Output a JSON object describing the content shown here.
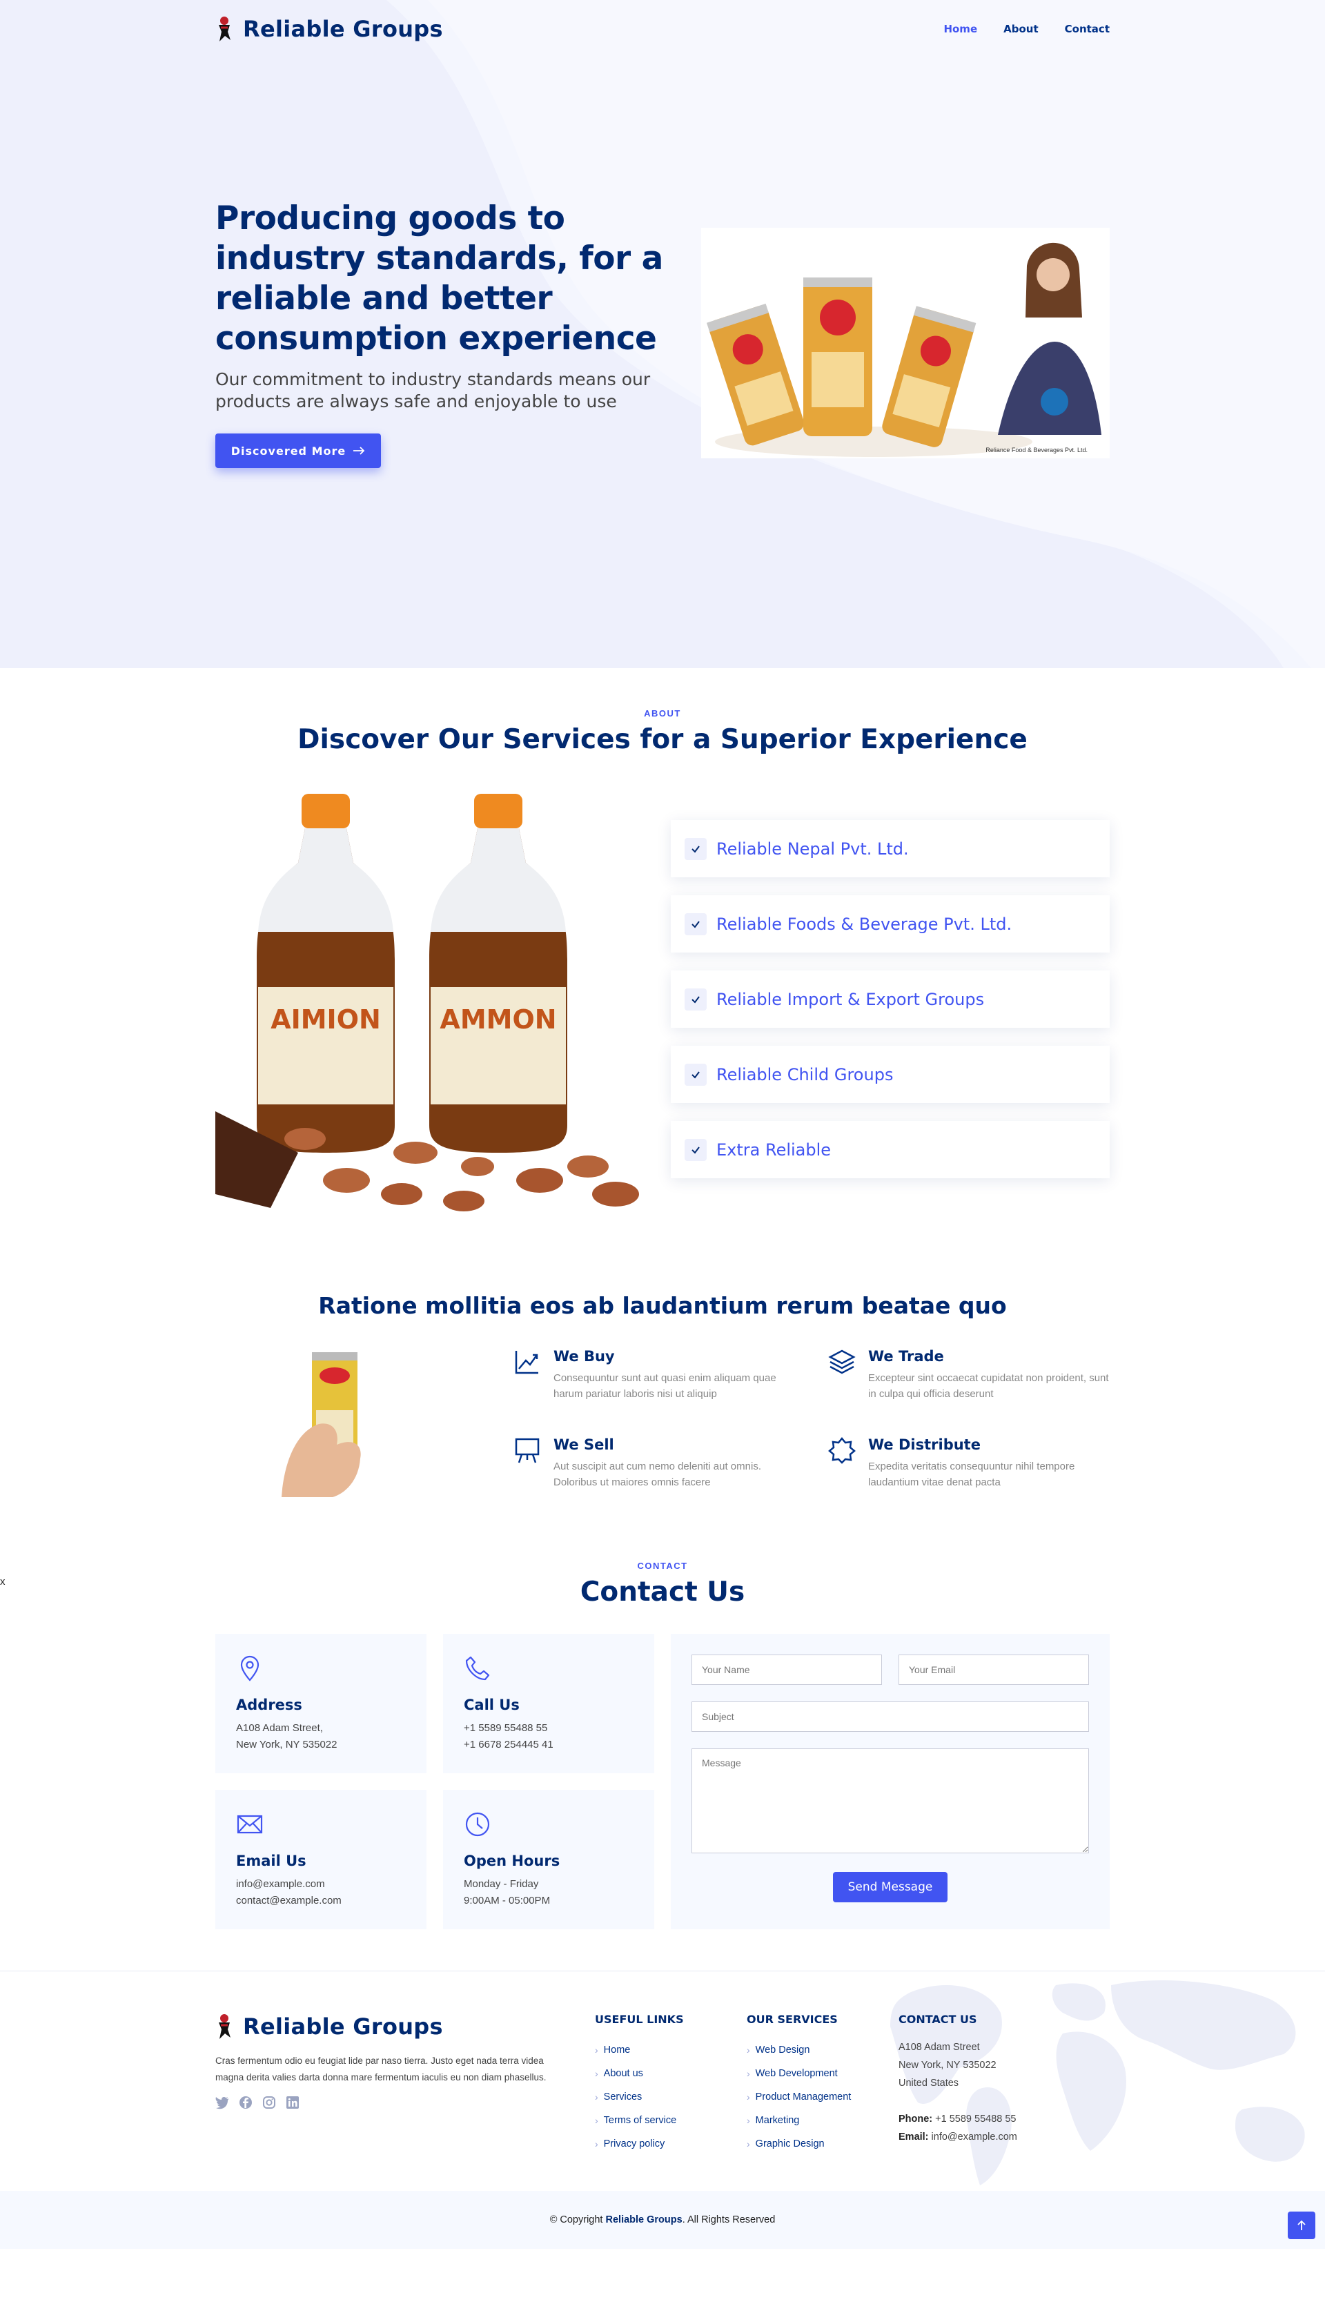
{
  "brand": {
    "name": "Reliable Groups"
  },
  "nav": {
    "home": "Home",
    "about": "About",
    "contact": "Contact"
  },
  "hero": {
    "title": "Producing goods to industry standards, for a reliable and better consumption experience",
    "subtitle": "Our commitment to industry standards means our products are always safe and enjoyable to use",
    "cta": "Discovered More",
    "image_caption": "Reliance Food & Beverages Pvt. Ltd."
  },
  "about": {
    "eyebrow": "About",
    "title": "Discover Our Services for a Superior Experience",
    "items": [
      "Reliable Nepal Pvt. Ltd.",
      "Reliable Foods & Beverage Pvt. Ltd.",
      "Reliable Import & Export Groups",
      "Reliable Child Groups",
      "Extra Reliable"
    ]
  },
  "features": {
    "title": "Ratione mollitia eos ab laudantium rerum beatae quo",
    "items": [
      {
        "title": "We Buy",
        "text": "Consequuntur sunt aut quasi enim aliquam quae harum pariatur laboris nisi ut aliquip",
        "icon": "graph-up-icon"
      },
      {
        "title": "We Trade",
        "text": "Excepteur sint occaecat cupidatat non proident, sunt in culpa qui officia deserunt",
        "icon": "layers-icon"
      },
      {
        "title": "We Sell",
        "text": "Aut suscipit aut cum nemo deleniti aut omnis. Doloribus ut maiores omnis facere",
        "icon": "easel-icon"
      },
      {
        "title": "We Distribute",
        "text": "Expedita veritatis consequuntur nihil tempore laudantium vitae denat pacta",
        "icon": "patch-check-icon"
      }
    ]
  },
  "stray_text": "x",
  "contact": {
    "eyebrow": "Contact",
    "title": "Contact Us",
    "boxes": [
      {
        "title": "Address",
        "line1": "A108 Adam Street,",
        "line2": "New York, NY 535022"
      },
      {
        "title": "Call Us",
        "line1": "+1 5589 55488 55",
        "line2": "+1 6678 254445 41"
      },
      {
        "title": "Email Us",
        "line1": "info@example.com",
        "line2": "contact@example.com"
      },
      {
        "title": "Open Hours",
        "line1": "Monday - Friday",
        "line2": "9:00AM - 05:00PM"
      }
    ],
    "form": {
      "name_placeholder": "Your Name",
      "email_placeholder": "Your Email",
      "subject_placeholder": "Subject",
      "message_placeholder": "Message",
      "submit": "Send Message"
    }
  },
  "footer": {
    "about_text": "Cras fermentum odio eu feugiat lide par naso tierra. Justo eget nada terra videa magna derita valies darta donna mare fermentum iaculis eu non diam phasellus.",
    "useful_links": {
      "title": "Useful Links",
      "items": [
        "Home",
        "About us",
        "Services",
        "Terms of service",
        "Privacy policy"
      ]
    },
    "services": {
      "title": "Our Services",
      "items": [
        "Web Design",
        "Web Development",
        "Product Management",
        "Marketing",
        "Graphic Design"
      ]
    },
    "contact": {
      "title": "Contact Us",
      "address1": "A108 Adam Street",
      "address2": "New York, NY 535022",
      "address3": "United States",
      "phone_label": "Phone:",
      "phone": "+1 5589 55488 55",
      "email_label": "Email:",
      "email": "info@example.com"
    },
    "copyright_prefix": "© Copyright",
    "copyright_brand": "Reliable Groups",
    "copyright_suffix": ". All Rights Reserved"
  },
  "colors": {
    "accent": "#4154f1",
    "navy": "#012970",
    "hero_bg": "#eef0fc",
    "panel_bg": "#f6f9ff"
  }
}
